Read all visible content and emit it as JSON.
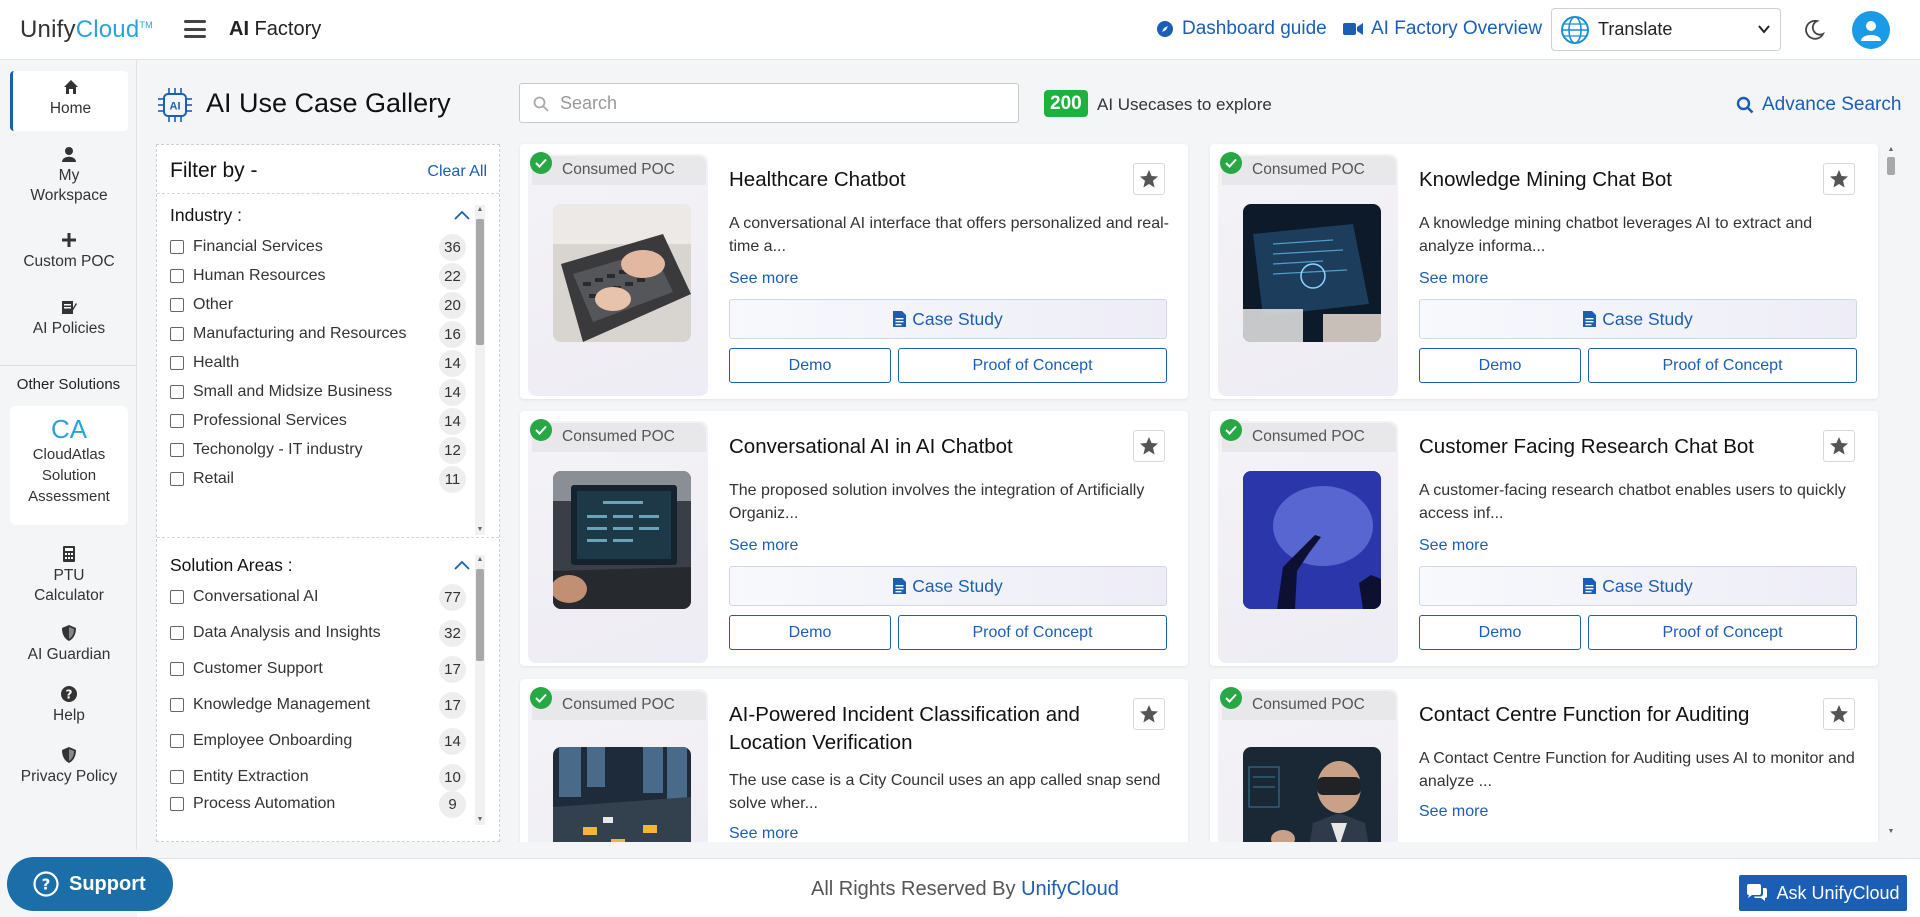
{
  "header": {
    "logo_main": "Unify",
    "logo_accent": "Cloud",
    "logo_tm": "TM",
    "app_name_prefix": "AI",
    "app_name_suffix": " Factory",
    "dashboard_guide": "Dashboard guide",
    "overview": "AI Factory Overview",
    "translate_label": "Translate"
  },
  "nav": {
    "home": "Home",
    "my_workspace_1": "My",
    "my_workspace_2": "Workspace",
    "custom_poc": "Custom POC",
    "ai_policies": "AI Policies",
    "other_solutions": "Other Solutions",
    "cloudatlas_logo": "CA",
    "cloudatlas_1": "CloudAtlas",
    "cloudatlas_2": "Solution",
    "cloudatlas_3": "Assessment",
    "ptu_1": "PTU",
    "ptu_2": "Calculator",
    "ai_guardian": "AI Guardian",
    "help": "Help",
    "privacy": "Privacy Policy"
  },
  "gallery": {
    "icon_text": "AI",
    "title": "AI Use Case Gallery",
    "search_placeholder": "Search",
    "count": "200",
    "count_text": "AI Usecases to explore",
    "advance_search": "Advance Search"
  },
  "filter": {
    "heading": "Filter by -",
    "clear_all": "Clear All",
    "industry_title": "Industry :",
    "industry": [
      {
        "label": "Financial Services",
        "count": "36"
      },
      {
        "label": "Human Resources",
        "count": "22"
      },
      {
        "label": "Other",
        "count": "20"
      },
      {
        "label": "Manufacturing and Resources",
        "count": "16"
      },
      {
        "label": "Health",
        "count": "14"
      },
      {
        "label": "Small and Midsize Business",
        "count": "14"
      },
      {
        "label": "Professional Services",
        "count": "14"
      },
      {
        "label": "Techonolgy - IT industry",
        "count": "12"
      },
      {
        "label": "Retail",
        "count": "11"
      }
    ],
    "solution_title": "Solution Areas :",
    "solution": [
      {
        "label": "Conversational AI",
        "count": "77"
      },
      {
        "label": "Data Analysis and Insights",
        "count": "32"
      },
      {
        "label": "Customer Support",
        "count": "17"
      },
      {
        "label": "Knowledge Management",
        "count": "17"
      },
      {
        "label": "Employee Onboarding",
        "count": "14"
      },
      {
        "label": "Entity Extraction",
        "count": "10"
      },
      {
        "label": "Process Automation",
        "count": "9"
      }
    ]
  },
  "cards": [
    {
      "tag": "Consumed POC",
      "title": "Healthcare Chatbot",
      "desc": "A conversational AI interface that offers personalized and real-time a...",
      "see_more": "See more",
      "case_study": "Case Study",
      "demo": "Demo",
      "poc": "Proof of Concept"
    },
    {
      "tag": "Consumed POC",
      "title": "Knowledge Mining Chat Bot",
      "desc": "A knowledge mining chatbot leverages AI to extract and analyze informa...",
      "see_more": "See more",
      "case_study": "Case Study",
      "demo": "Demo",
      "poc": "Proof of Concept"
    },
    {
      "tag": "Consumed POC",
      "title": "Conversational AI in AI Chatbot",
      "desc": "The proposed solution involves the integration of Artificially Organiz...",
      "see_more": "See more",
      "case_study": "Case Study",
      "demo": "Demo",
      "poc": "Proof of Concept"
    },
    {
      "tag": "Consumed POC",
      "title": "Customer Facing Research Chat Bot",
      "desc": "A customer-facing research chatbot enables users to quickly access inf...",
      "see_more": "See more",
      "case_study": "Case Study",
      "demo": "Demo",
      "poc": "Proof of Concept"
    },
    {
      "tag": "Consumed POC",
      "title": "AI-Powered Incident Classification and Location Verification",
      "desc": "The use case is a City Council uses an app called snap send solve wher...",
      "see_more": "See more"
    },
    {
      "tag": "Consumed POC",
      "title": "Contact Centre Function for Auditing",
      "desc": "A Contact Centre Function for Auditing uses AI to monitor and analyze ...",
      "see_more": "See more"
    }
  ],
  "footer": {
    "text": "All Rights Reserved By ",
    "brand": "UnifyCloud",
    "support": "Support",
    "ask": "Ask UnifyCloud"
  },
  "colors": {
    "accent": "#1b5eb5",
    "brand_cyan": "#2aa3dc",
    "badge_green": "#1db13e",
    "check_green": "#28a745",
    "support_blue": "#1b6ea8"
  },
  "icons": [
    "menu-icon",
    "compass-icon",
    "video-icon",
    "globe-icon",
    "moon-icon",
    "user-icon",
    "home-icon",
    "user-icon",
    "plus-icon",
    "policy-icon",
    "calculator-icon",
    "shield-icon",
    "question-icon",
    "search-icon",
    "star-icon",
    "check-icon",
    "document-icon",
    "chat-icon"
  ]
}
